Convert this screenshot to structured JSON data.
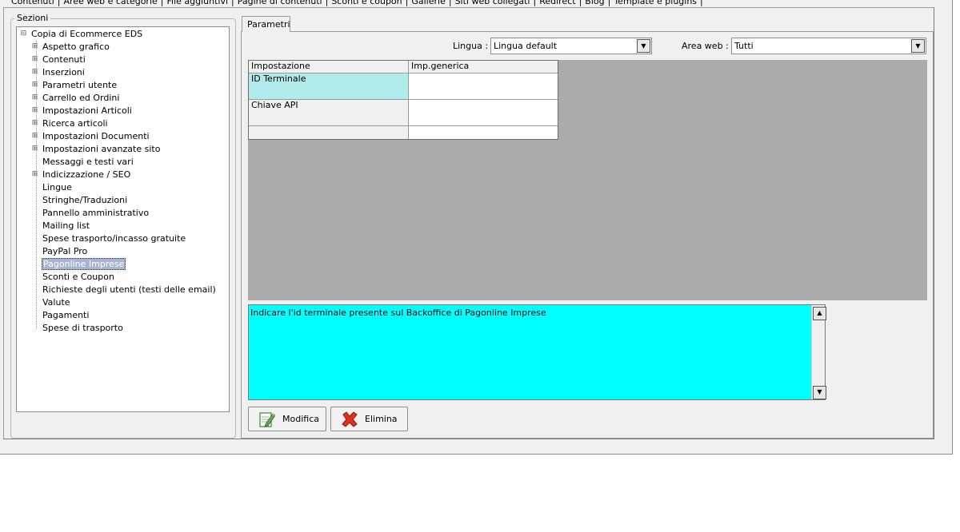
{
  "top_tabs": [
    "Contenuti",
    "Aree web e categorie",
    "File aggiuntivi",
    "Pagine di contenuti",
    "Sconti e coupon",
    "Gallerie",
    "Siti web collegati",
    "Redirect",
    "Blog",
    "Template e plugins"
  ],
  "sections": {
    "label": "Sezioni",
    "root": "Copia di Ecommerce EDS",
    "items": [
      {
        "label": "Aspetto grafico",
        "expandable": true
      },
      {
        "label": "Contenuti",
        "expandable": true
      },
      {
        "label": "Inserzioni",
        "expandable": true
      },
      {
        "label": "Parametri utente",
        "expandable": true
      },
      {
        "label": "Carrello ed Ordini",
        "expandable": true
      },
      {
        "label": "Impostazioni Articoli",
        "expandable": true
      },
      {
        "label": "Ricerca articoli",
        "expandable": true
      },
      {
        "label": "Impostazioni Documenti",
        "expandable": true
      },
      {
        "label": "Impostazioni avanzate sito",
        "expandable": true
      },
      {
        "label": "Messaggi e testi vari",
        "expandable": false
      },
      {
        "label": "Indicizzazione / SEO",
        "expandable": true
      },
      {
        "label": "Lingue",
        "expandable": false
      },
      {
        "label": "Stringhe/Traduzioni",
        "expandable": false
      },
      {
        "label": "Pannello amministrativo",
        "expandable": false
      },
      {
        "label": "Mailing list",
        "expandable": false
      },
      {
        "label": "Spese trasporto/incasso gratuite",
        "expandable": false
      },
      {
        "label": "PayPal Pro",
        "expandable": false
      },
      {
        "label": "Pagonline Imprese",
        "expandable": false,
        "selected": true
      },
      {
        "label": "Sconti e Coupon",
        "expandable": false
      },
      {
        "label": "Richieste degli utenti (testi delle email)",
        "expandable": false
      },
      {
        "label": "Valute",
        "expandable": false
      },
      {
        "label": "Pagamenti",
        "expandable": false
      },
      {
        "label": "Spese di trasporto",
        "expandable": false
      }
    ]
  },
  "params_tab": {
    "label": "Parametri"
  },
  "lingua": {
    "label": "Lingua :",
    "value": "Lingua default"
  },
  "area_web": {
    "label": "Area web :",
    "value": "Tutti"
  },
  "grid": {
    "headers": [
      "Impostazione",
      "Imp.generica"
    ],
    "rows": [
      {
        "setting": "ID Terminale",
        "value": ""
      },
      {
        "setting": "Chiave API",
        "value": ""
      },
      {
        "setting": "",
        "value": ""
      }
    ]
  },
  "description": {
    "text": "Indicare l'id terminale presente sul Backoffice di Pagonline Imprese"
  },
  "buttons": {
    "modifica": "Modifica",
    "elimina": "Elimina"
  },
  "colors": {
    "selected_row": "#b2ebeb",
    "description_bg": "#00ffff",
    "grid_bg": "#ababab"
  }
}
